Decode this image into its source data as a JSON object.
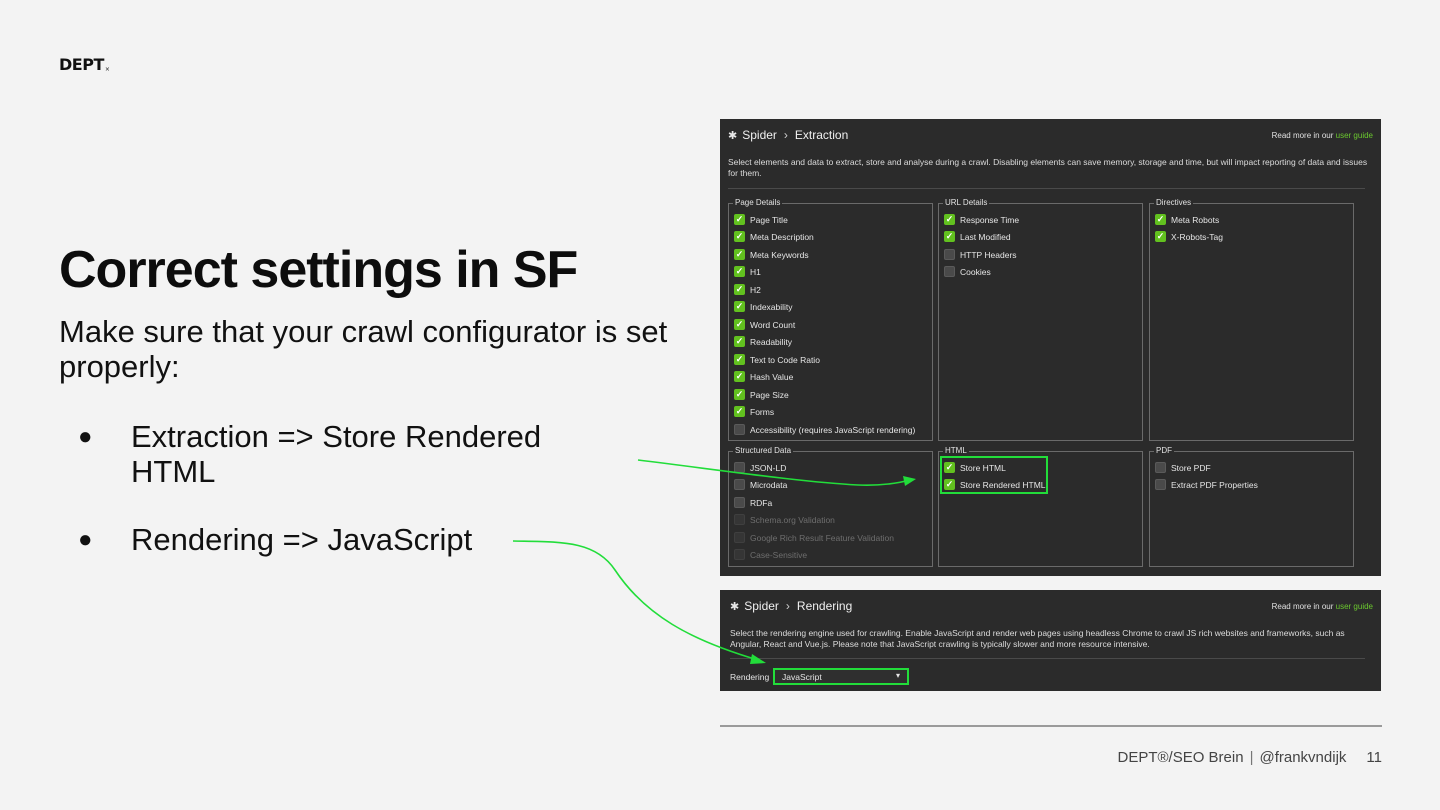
{
  "slide": {
    "logo": "DEPT",
    "logo_mark": "×",
    "title": "Correct settings in SF",
    "subtitle": "Make sure that your crawl configurator is set properly:",
    "bullets": [
      {
        "marker": "●",
        "text_line1": "Extraction => Store Rendered",
        "text_line2": "HTML"
      },
      {
        "marker": "●",
        "text_line1": "Rendering => JavaScript"
      }
    ],
    "arrow_color": "#22dd3a"
  },
  "extraction": {
    "gear_icon": "gear-icon",
    "crumb1": "Spider",
    "separator": "›",
    "crumb2": "Extraction",
    "readmore_prefix": "Read more in our",
    "readmore_link": "user guide",
    "description": "Select elements and data to extract, store and analyse during a crawl. Disabling elements can save memory, storage and time, but will impact reporting of data and issues for them.",
    "groups": {
      "page_details": {
        "title": "Page Details",
        "items": [
          {
            "label": "Page Title",
            "checked": true
          },
          {
            "label": "Meta Description",
            "checked": true
          },
          {
            "label": "Meta Keywords",
            "checked": true
          },
          {
            "label": "H1",
            "checked": true
          },
          {
            "label": "H2",
            "checked": true
          },
          {
            "label": "Indexability",
            "checked": true
          },
          {
            "label": "Word Count",
            "checked": true
          },
          {
            "label": "Readability",
            "checked": true
          },
          {
            "label": "Text to Code Ratio",
            "checked": true
          },
          {
            "label": "Hash Value",
            "checked": true
          },
          {
            "label": "Page Size",
            "checked": true
          },
          {
            "label": "Forms",
            "checked": true
          },
          {
            "label": "Accessibility (requires JavaScript rendering)",
            "checked": false
          }
        ]
      },
      "url_details": {
        "title": "URL Details",
        "items": [
          {
            "label": "Response Time",
            "checked": true
          },
          {
            "label": "Last Modified",
            "checked": true
          },
          {
            "label": "HTTP Headers",
            "checked": false
          },
          {
            "label": "Cookies",
            "checked": false
          }
        ]
      },
      "directives": {
        "title": "Directives",
        "items": [
          {
            "label": "Meta Robots",
            "checked": true
          },
          {
            "label": "X-Robots-Tag",
            "checked": true
          }
        ]
      },
      "structured_data": {
        "title": "Structured Data",
        "items": [
          {
            "label": "JSON-LD",
            "checked": false
          },
          {
            "label": "Microdata",
            "checked": false
          },
          {
            "label": "RDFa",
            "checked": false
          },
          {
            "label": "Schema.org Validation",
            "checked": false,
            "disabled": true
          },
          {
            "label": "Google Rich Result Feature Validation",
            "checked": false,
            "disabled": true
          },
          {
            "label": "Case-Sensitive",
            "checked": false,
            "disabled": true
          }
        ]
      },
      "html": {
        "title": "HTML",
        "items": [
          {
            "label": "Store HTML",
            "checked": true
          },
          {
            "label": "Store Rendered HTML",
            "checked": true
          }
        ]
      },
      "pdf": {
        "title": "PDF",
        "items": [
          {
            "label": "Store PDF",
            "checked": false
          },
          {
            "label": "Extract PDF Properties",
            "checked": false
          }
        ]
      }
    }
  },
  "rendering": {
    "gear_icon": "gear-icon",
    "crumb1": "Spider",
    "separator": "›",
    "crumb2": "Rendering",
    "readmore_prefix": "Read more in our",
    "readmore_link": "user guide",
    "description": "Select the rendering engine used for crawling. Enable JavaScript and render web pages using headless Chrome to crawl JS rich websites and frameworks, such as Angular, React and Vue.js. Please note that JavaScript crawling is typically slower and more resource intensive.",
    "label": "Rendering",
    "selected": "JavaScript"
  },
  "footer": {
    "brand": "DEPT®/SEO Brein",
    "divider": "|",
    "handle": "@frankvndijk",
    "page_number": "11"
  }
}
